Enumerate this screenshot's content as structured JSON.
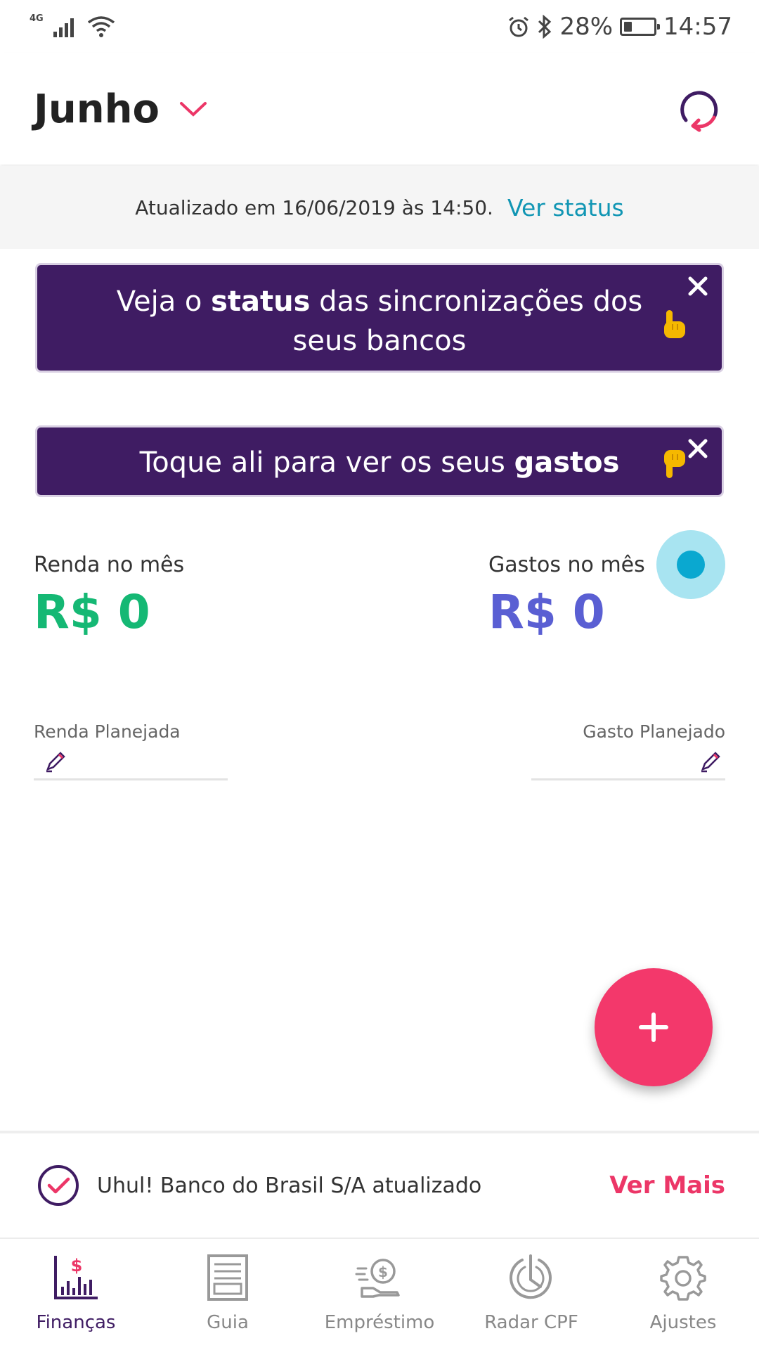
{
  "status_bar": {
    "network": "4G",
    "battery": "28%",
    "battery_level": 0.28,
    "time": "14:57"
  },
  "header": {
    "month": "Junho"
  },
  "update_bar": {
    "text": "Atualizado em 16/06/2019 às 14:50.",
    "link": "Ver status"
  },
  "tips": {
    "sync": {
      "before": "Veja o ",
      "bold": "status",
      "after": " das sincronizações dos seus bancos"
    },
    "expenses": {
      "before": "Toque ali para ver os seus ",
      "bold": "gastos"
    }
  },
  "summary": {
    "income_label": "Renda no mês",
    "income_value": "R$ 0",
    "expense_label": "Gastos no mês",
    "expense_value": "R$ 0"
  },
  "planned": {
    "income_label": "Renda Planejada",
    "expense_label": "Gasto Planejado"
  },
  "notice": {
    "text": "Uhul! Banco do Brasil S/A atualizado",
    "link": "Ver Mais"
  },
  "nav": [
    {
      "label": "Finanças"
    },
    {
      "label": "Guia"
    },
    {
      "label": "Empréstimo"
    },
    {
      "label": "Radar CPF"
    },
    {
      "label": "Ajustes"
    }
  ],
  "colors": {
    "primary": "#3f1c63",
    "accent": "#f3386b",
    "income": "#15b874",
    "expense": "#5a5fd3",
    "link": "#1196b4"
  },
  "icons": {
    "header_right": "sync-icon",
    "fab": "plus-icon",
    "nav": [
      "finance-chart-icon",
      "guide-icon",
      "loan-icon",
      "radar-icon",
      "settings-icon"
    ]
  }
}
